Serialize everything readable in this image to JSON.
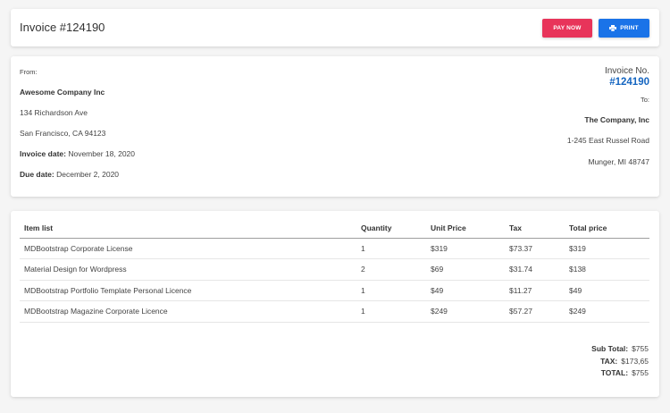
{
  "header": {
    "title": "Invoice #124190",
    "pay_now_label": "PAY NOW",
    "print_label": "PRINT",
    "colors": {
      "pay_now": "#e8345a",
      "print": "#1a73e8"
    }
  },
  "from": {
    "label": "From:",
    "company": "Awesome Company Inc",
    "address_line1": "134 Richardson Ave",
    "address_line2": "San Francisco, CA 94123",
    "invoice_date_label": "Invoice date:",
    "invoice_date": "November 18, 2020",
    "due_date_label": "Due date:",
    "due_date": "December 2, 2020"
  },
  "invoice": {
    "number_label": "Invoice No.",
    "number": "#124190",
    "number_color": "#1565c0"
  },
  "to": {
    "label": "To:",
    "company": "The Company, Inc",
    "address_line1": "1-245 East Russel Road",
    "address_line2": "Munger, MI 48747"
  },
  "table": {
    "headers": [
      "Item list",
      "Quantity",
      "Unit Price",
      "Tax",
      "Total price"
    ],
    "rows": [
      [
        "MDBootstrap Corporate License",
        "1",
        "$319",
        "$73.37",
        "$319"
      ],
      [
        "Material Design for Wordpress",
        "2",
        "$69",
        "$31.74",
        "$138"
      ],
      [
        "MDBootstrap Portfolio Template Personal Licence",
        "1",
        "$49",
        "$11.27",
        "$49"
      ],
      [
        "MDBootstrap Magazine Corporate Licence",
        "1",
        "$249",
        "$57.27",
        "$249"
      ]
    ]
  },
  "totals": {
    "subtotal_label": "Sub Total:",
    "subtotal": "$755",
    "tax_label": "TAX:",
    "tax": "$173,65",
    "total_label": "TOTAL:",
    "total": "$755"
  }
}
